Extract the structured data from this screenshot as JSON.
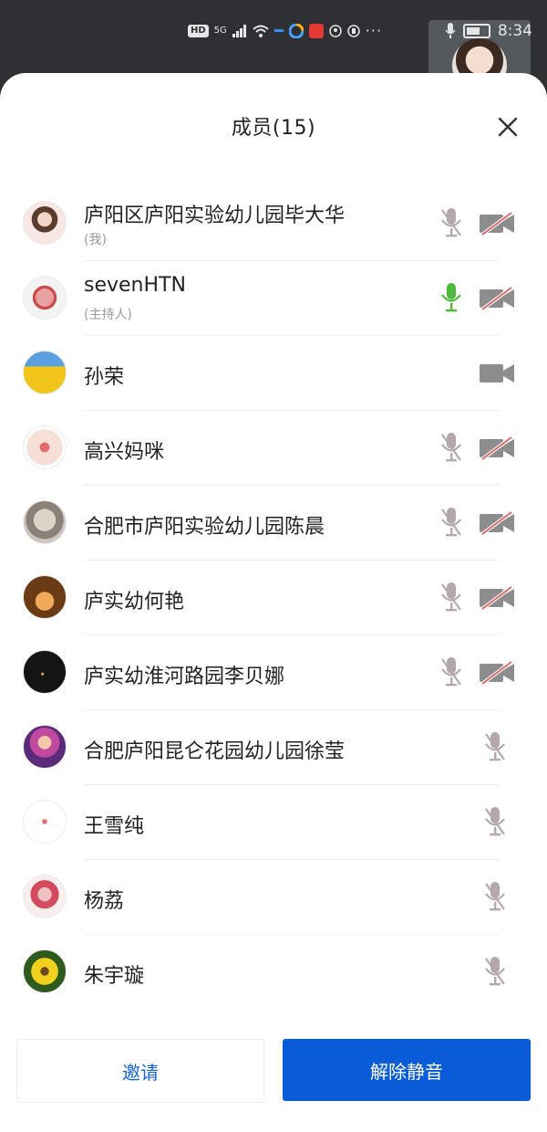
{
  "status_bar": {
    "hd_label": "HD",
    "network_label": "5G",
    "dots": "···",
    "time": "8:34"
  },
  "sheet": {
    "title": "成员(15)",
    "close_icon": "close-icon"
  },
  "colors": {
    "mic_muted": "#b4a8ae",
    "mic_active": "#4fba3d",
    "camera_off_slash": "#d86a6a",
    "camera": "#8d8d8d",
    "primary_blue": "#0a5bd8",
    "invite_text_blue": "#1565d8"
  },
  "members": [
    {
      "name": "庐阳区庐阳实验幼儿园毕大华",
      "role": "(我)",
      "mic": "muted",
      "camera": "off"
    },
    {
      "name": "sevenHTN",
      "role": "(主持人)",
      "mic": "active",
      "camera": "off"
    },
    {
      "name": "孙荣",
      "role": "",
      "mic": "none",
      "camera": "on"
    },
    {
      "name": "高兴妈咪",
      "role": "",
      "mic": "muted",
      "camera": "off"
    },
    {
      "name": "合肥市庐阳实验幼儿园陈晨",
      "role": "",
      "mic": "muted",
      "camera": "off"
    },
    {
      "name": "庐实幼何艳",
      "role": "",
      "mic": "muted",
      "camera": "off"
    },
    {
      "name": "庐实幼淮河路园李贝娜",
      "role": "",
      "mic": "muted",
      "camera": "off"
    },
    {
      "name": "合肥庐阳昆仑花园幼儿园徐莹",
      "role": "",
      "mic": "muted",
      "camera": "none"
    },
    {
      "name": "王雪纯",
      "role": "",
      "mic": "muted",
      "camera": "none"
    },
    {
      "name": "杨荔",
      "role": "",
      "mic": "muted",
      "camera": "none"
    },
    {
      "name": "朱宇璇",
      "role": "",
      "mic": "muted",
      "camera": "none"
    }
  ],
  "footer": {
    "invite_label": "邀请",
    "unmute_label": "解除静音"
  }
}
